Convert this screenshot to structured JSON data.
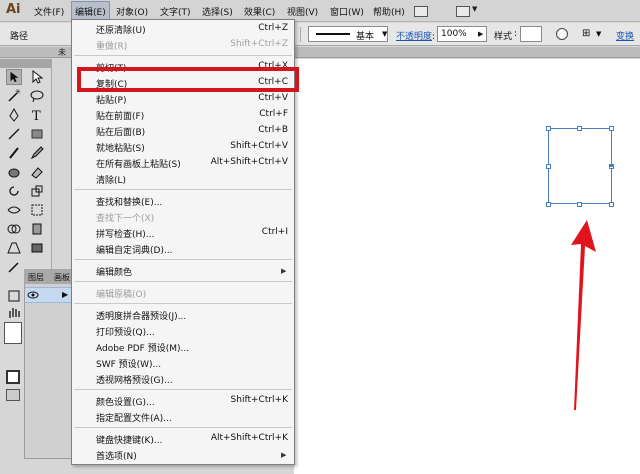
{
  "app": {
    "logo": "Ai"
  },
  "menubar": {
    "items": [
      "文件(F)",
      "编辑(E)",
      "对象(O)",
      "文字(T)",
      "选择(S)",
      "效果(C)",
      "视图(V)",
      "窗口(W)",
      "帮助(H)"
    ]
  },
  "control_bar": {
    "left_label": "路径",
    "stroke_profile": "基本",
    "opacity_label": "不透明度",
    "opacity_value": "100%",
    "style_label": "样式",
    "transform_label": "变换"
  },
  "document": {
    "tab_fragment": "未"
  },
  "layers_panel": {
    "tab_layers": "图层",
    "tab_artboards": "画板"
  },
  "edit_menu": {
    "items": [
      {
        "label": "还原清除(U)",
        "shortcut": "Ctrl+Z",
        "disabled": false
      },
      {
        "label": "重做(R)",
        "shortcut": "Shift+Ctrl+Z",
        "disabled": true
      },
      {
        "label": "剪切(T)",
        "shortcut": "Ctrl+X",
        "disabled": false
      },
      {
        "label": "复制(C)",
        "shortcut": "Ctrl+C",
        "disabled": false
      },
      {
        "label": "粘贴(P)",
        "shortcut": "Ctrl+V",
        "disabled": false
      },
      {
        "label": "贴在前面(F)",
        "shortcut": "Ctrl+F",
        "disabled": false
      },
      {
        "label": "贴在后面(B)",
        "shortcut": "Ctrl+B",
        "disabled": false
      },
      {
        "label": "就地粘贴(S)",
        "shortcut": "Shift+Ctrl+V",
        "disabled": false
      },
      {
        "label": "在所有画板上粘贴(S)",
        "shortcut": "Alt+Shift+Ctrl+V",
        "disabled": false
      },
      {
        "label": "清除(L)",
        "shortcut": "",
        "disabled": false
      },
      {
        "label": "查找和替换(E)...",
        "shortcut": "",
        "disabled": false
      },
      {
        "label": "查找下一个(X)",
        "shortcut": "",
        "disabled": true
      },
      {
        "label": "拼写检查(H)...",
        "shortcut": "Ctrl+I",
        "disabled": false
      },
      {
        "label": "编辑自定词典(D)...",
        "shortcut": "",
        "disabled": false
      },
      {
        "label": "编辑颜色",
        "shortcut": "",
        "disabled": false,
        "submenu": true
      },
      {
        "label": "编辑原稿(O)",
        "shortcut": "",
        "disabled": true
      },
      {
        "label": "透明度拼合器预设(J)...",
        "shortcut": "",
        "disabled": false
      },
      {
        "label": "打印预设(Q)...",
        "shortcut": "",
        "disabled": false
      },
      {
        "label": "Adobe PDF 预设(M)...",
        "shortcut": "",
        "disabled": false
      },
      {
        "label": "SWF 预设(W)...",
        "shortcut": "",
        "disabled": false
      },
      {
        "label": "透视网格预设(G)...",
        "shortcut": "",
        "disabled": false
      },
      {
        "label": "颜色设置(G)...",
        "shortcut": "Shift+Ctrl+K",
        "disabled": false
      },
      {
        "label": "指定配置文件(A)...",
        "shortcut": "",
        "disabled": false
      },
      {
        "label": "键盘快捷键(K)...",
        "shortcut": "Alt+Shift+Ctrl+K",
        "disabled": false
      },
      {
        "label": "首选项(N)",
        "shortcut": "",
        "disabled": false,
        "submenu": true
      }
    ]
  },
  "colors": {
    "highlight_box": "#d4141f",
    "selection": "#4a7fc2",
    "arrow": "#e0141c",
    "menu_bg": "#f5f5f5",
    "layer_selected": "#c5d9f0"
  }
}
